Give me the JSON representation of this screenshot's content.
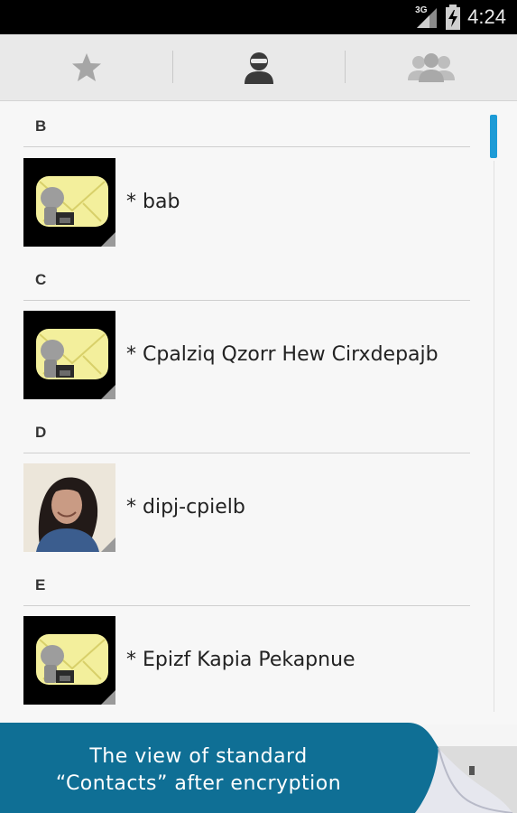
{
  "status_bar": {
    "network": "3G",
    "time": "4:24",
    "icons": [
      "signal-icon",
      "battery-charging-icon"
    ]
  },
  "tabs": [
    {
      "name": "favorites",
      "icon": "star-icon",
      "selected": false
    },
    {
      "name": "contacts",
      "icon": "person-icon",
      "selected": true
    },
    {
      "name": "groups",
      "icon": "group-icon",
      "selected": false
    }
  ],
  "sections": [
    {
      "letter": "B",
      "contacts": [
        {
          "name": "* bab",
          "avatar": "encrypted-envelope-avatar"
        }
      ]
    },
    {
      "letter": "C",
      "contacts": [
        {
          "name": "* Cpalziq Qzorr Hew Cirxdepajb",
          "avatar": "encrypted-envelope-avatar"
        }
      ]
    },
    {
      "letter": "D",
      "contacts": [
        {
          "name": "* dipj-cpielb",
          "avatar": "photo-avatar"
        }
      ]
    },
    {
      "letter": "E",
      "contacts": [
        {
          "name": "* Epizf Kapia Pekapnue",
          "avatar": "encrypted-envelope-avatar"
        }
      ]
    }
  ],
  "banner": {
    "line1": "The view of standard",
    "line2": "“Contacts” after encryption"
  },
  "colors": {
    "accent": "#1d9bd6",
    "banner": "#0f6f95",
    "envelope": "#f3ef9c"
  }
}
